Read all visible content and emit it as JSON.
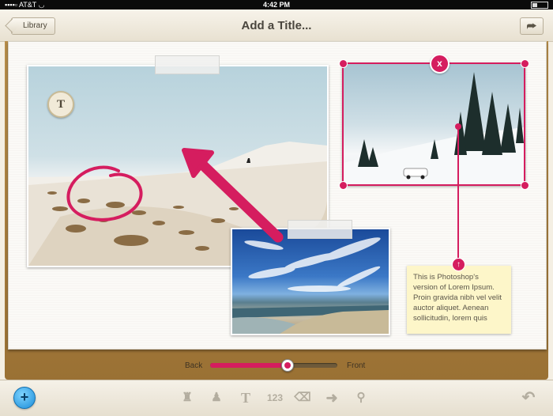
{
  "status_bar": {
    "carrier": "AT&T",
    "time": "4:42 PM"
  },
  "nav": {
    "back_label": "Library",
    "title": "Add a Title..."
  },
  "sticky_note": {
    "text": "This is Photoshop's version of Lorem Ipsum. Proin gravida nibh vel velit auctor aliquet. Aenean sollicitudin, lorem quis"
  },
  "text_badge": {
    "letter": "T"
  },
  "selection": {
    "close_glyph": "x"
  },
  "layer_slider": {
    "back_label": "Back",
    "front_label": "Front",
    "value_fraction": 0.6
  },
  "toolbar": {
    "number_label": "123",
    "text_tool_label": "T"
  },
  "colors": {
    "accent": "#d51d5f",
    "leather": "#a87d3c",
    "add_button": "#2a9be3"
  },
  "icons": [
    "wifi-icon",
    "battery-icon",
    "share-icon",
    "stamp-icon",
    "stamp-small-icon",
    "text-tool-icon",
    "numbers-tool-icon",
    "delete-tool-icon",
    "arrow-tool-icon",
    "pin-tool-icon",
    "undo-icon",
    "add-icon"
  ]
}
